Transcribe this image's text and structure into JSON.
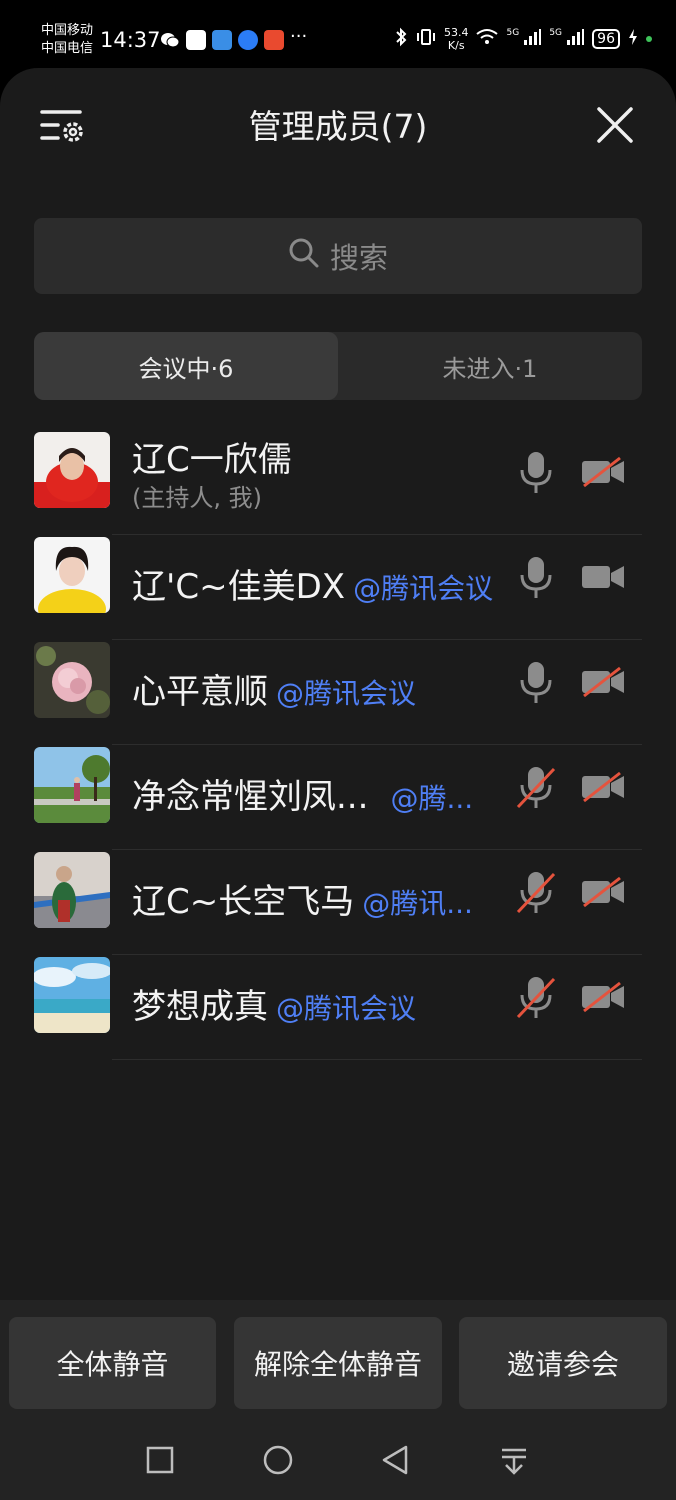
{
  "status": {
    "carrier1": "中国移动",
    "carrier2": "中国电信",
    "time": "14:37",
    "more": "···",
    "net_speed": "53.4",
    "net_unit": "K/s",
    "sig1": "5G",
    "sig2": "5G",
    "battery": "96"
  },
  "header": {
    "title": "管理成员(7)"
  },
  "search": {
    "placeholder": "搜索"
  },
  "tabs": [
    {
      "label": "会议中·6",
      "active": true
    },
    {
      "label": "未进入·1",
      "active": false
    }
  ],
  "members": [
    {
      "name": "辽C一欣儒",
      "sub": "(主持人, 我)",
      "tag": "",
      "mic": "on",
      "cam": "off"
    },
    {
      "name": "辽'C~佳美DX",
      "sub": "",
      "tag": "@腾讯会议",
      "mic": "on",
      "cam": "on"
    },
    {
      "name": "心平意顺",
      "sub": "",
      "tag": "@腾讯会议",
      "mic": "on",
      "cam": "off"
    },
    {
      "name": "净念常惺刘凤...",
      "sub": "",
      "tag": "@腾...",
      "mic": "off",
      "cam": "off"
    },
    {
      "name": "辽C~长空飞马",
      "sub": "",
      "tag": "@腾讯...",
      "mic": "off",
      "cam": "off"
    },
    {
      "name": "梦想成真",
      "sub": "",
      "tag": "@腾讯会议",
      "mic": "off",
      "cam": "off"
    }
  ],
  "actions": {
    "mute_all": "全体静音",
    "unmute_all": "解除全体静音",
    "invite": "邀请参会"
  },
  "colors": {
    "accent": "#4f7ff5",
    "mute_red": "#e5533d"
  }
}
